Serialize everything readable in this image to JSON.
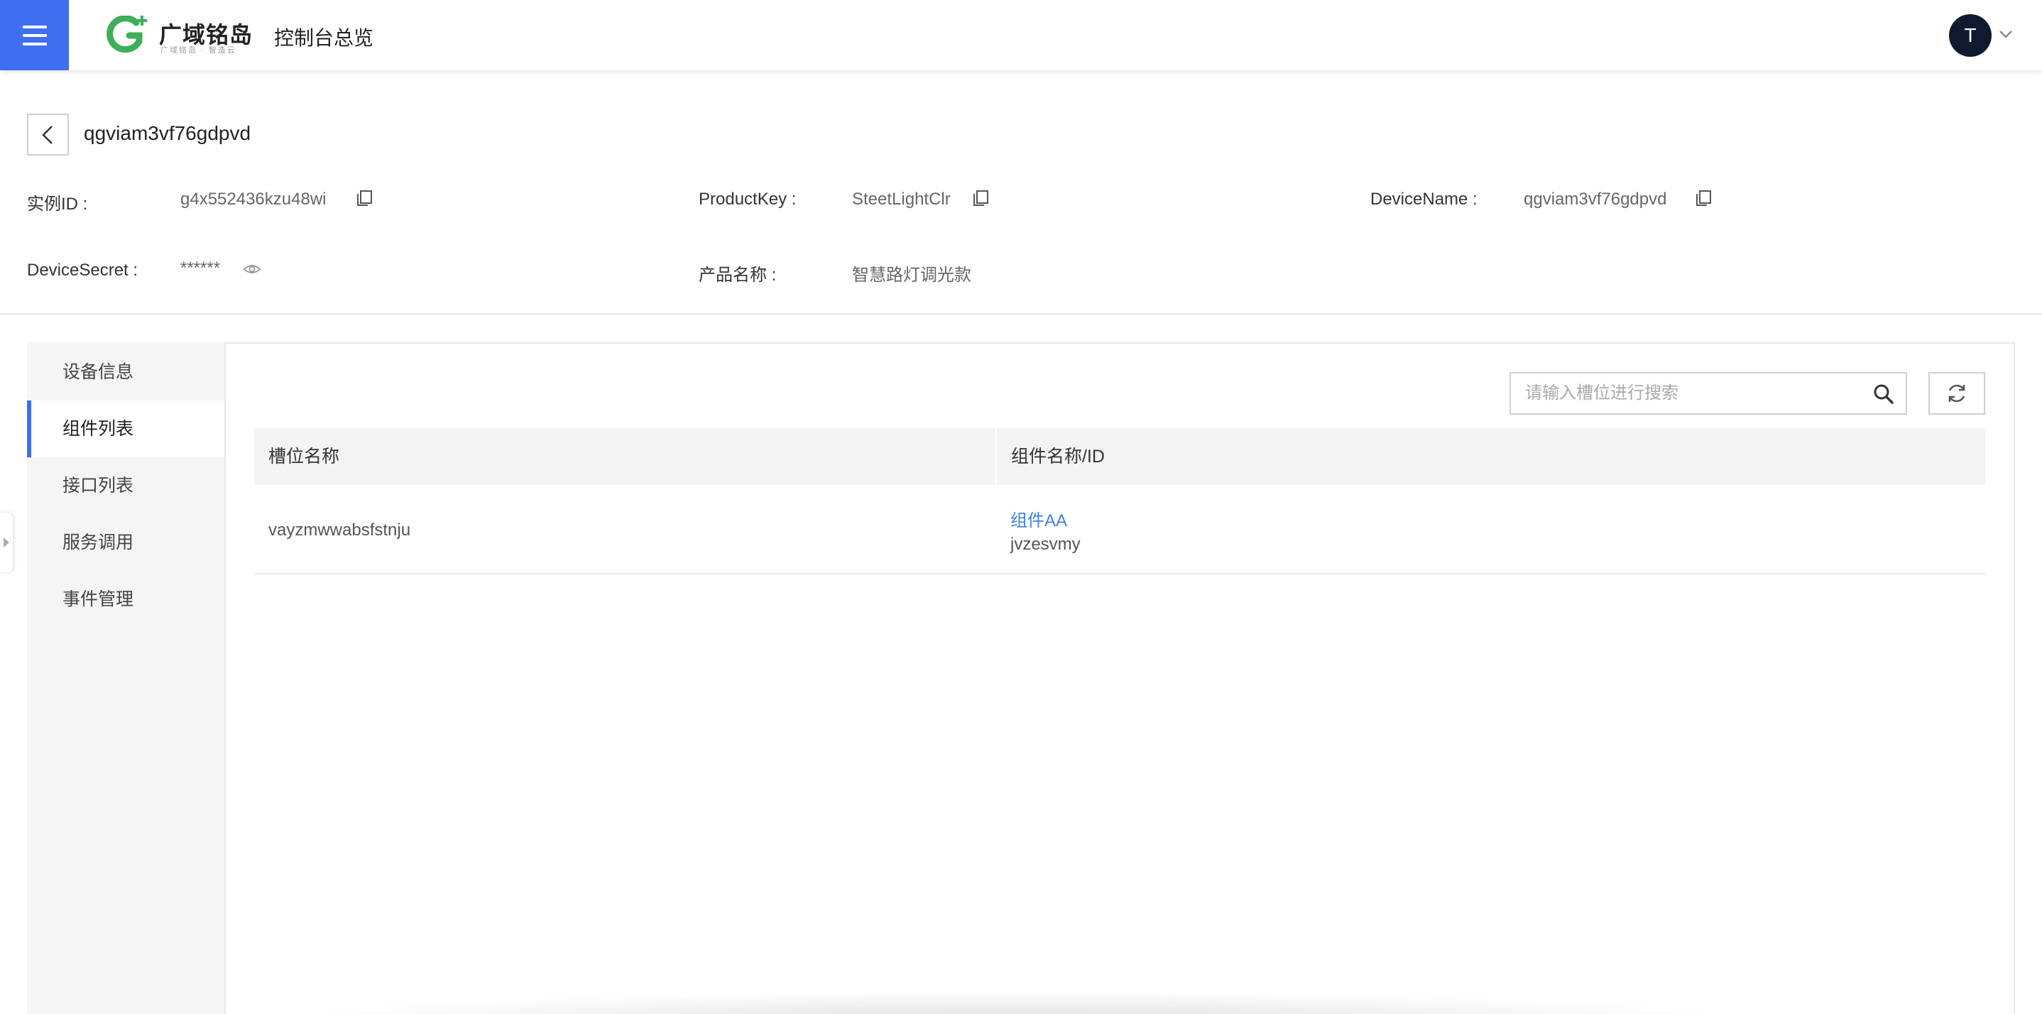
{
  "header": {
    "logo_name": "广域铭岛",
    "logo_slogan": "广域铭岛 · 智造云",
    "console_title": "控制台总览",
    "avatar_initial": "T"
  },
  "device": {
    "title": "qgviam3vf76gdpvd",
    "fields": [
      {
        "label": "实例ID :",
        "value": "g4x552436kzu48wi",
        "action": "copy"
      },
      {
        "label": "ProductKey :",
        "value": "SteetLightClr",
        "action": "copy"
      },
      {
        "label": "DeviceName :",
        "value": "qgviam3vf76gdpvd",
        "action": "copy"
      },
      {
        "label": "DeviceSecret :",
        "value": "******",
        "action": "reveal"
      },
      {
        "label": "产品名称 :",
        "value": "智慧路灯调光款",
        "action": ""
      }
    ]
  },
  "sidenav": {
    "items": [
      {
        "label": "设备信息",
        "active": false
      },
      {
        "label": "组件列表",
        "active": true
      },
      {
        "label": "接口列表",
        "active": false
      },
      {
        "label": "服务调用",
        "active": false
      },
      {
        "label": "事件管理",
        "active": false
      }
    ]
  },
  "search": {
    "placeholder": "请输入槽位进行搜索",
    "value": ""
  },
  "table": {
    "columns": [
      "槽位名称",
      "组件名称/ID"
    ],
    "rows": [
      {
        "slot": "vayzmwwabsfstnju",
        "component_name": "组件AA",
        "component_id": "jvzesvmy"
      }
    ]
  },
  "colors": {
    "primary": "#3f6ff0",
    "link": "#3f7ee8",
    "avatar_bg": "#0f1a2e",
    "logo_green": "#3fae5a"
  },
  "icons": {
    "menu": "hamburger-menu-icon",
    "back": "chevron-left-icon",
    "copy": "copy-icon",
    "reveal": "eye-icon",
    "search": "search-icon",
    "refresh": "refresh-icon",
    "avatar_caret": "chevron-down-icon"
  }
}
